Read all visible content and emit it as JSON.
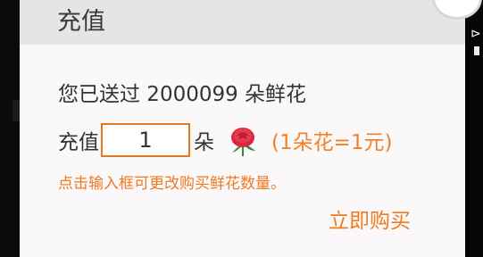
{
  "dialog": {
    "title": "充值",
    "sent_text": "您已送过 2000099 朵鲜花",
    "recharge_label": "充值",
    "quantity_value": "1",
    "unit_label": "朵",
    "flower_icon": "rose-icon",
    "rate_text": "(1朵花=1元)",
    "hint_text": "点击输入框可更改购买鲜花数量。",
    "buy_label": "立即购买"
  },
  "colors": {
    "accent": "#ef7a22",
    "header_bg": "#e5e5e5",
    "dialog_bg": "#fbf8fa"
  }
}
